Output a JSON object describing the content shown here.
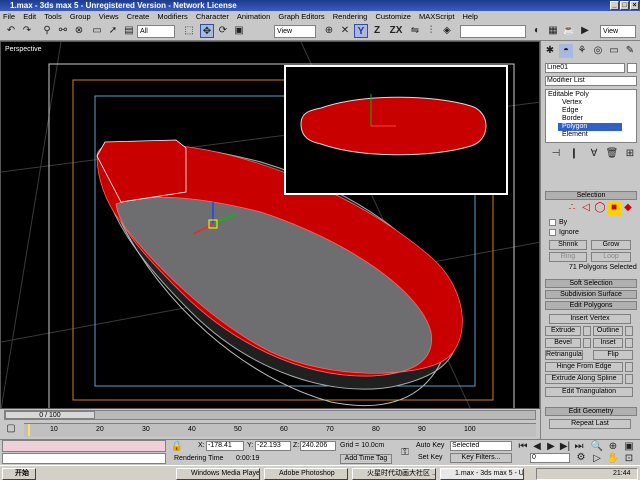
{
  "window": {
    "title": "1.max - 3ds max 5 - Unregistered Version - Network License"
  },
  "menu": [
    "File",
    "Edit",
    "Tools",
    "Group",
    "Views",
    "Create",
    "Modifiers",
    "Character",
    "Animation",
    "Graph Editors",
    "Rendering",
    "Customize",
    "MAXScript",
    "Help"
  ],
  "toolbar": {
    "selection_filter": "All",
    "ref_coord": "View",
    "ref_coord2": "View",
    "axis_y": "Y",
    "axis_z": "Z",
    "axis_zx": "ZX"
  },
  "viewport": {
    "label": "Perspective"
  },
  "command_panel": {
    "object_name": "Line01",
    "modifier_list": "Modifier List",
    "stack": [
      "Editable Poly",
      "Vertex",
      "Edge",
      "Border",
      "Polygon",
      "Element"
    ],
    "selection_head": "Selection",
    "by_label": "By",
    "ignore_label": "Ignore",
    "shrink": "Shrink",
    "grow": "Grow",
    "ring": "Ring",
    "loop": "Loop",
    "polys_selected": "71 Polygons Selected",
    "soft_selection": "Soft Selection",
    "subdivision_surface": "Subdivision Surface",
    "edit_polygons": "Edit Polygons",
    "insert_vertex": "Insert Vertex",
    "extrude": "Extrude",
    "outline": "Outline",
    "bevel": "Bevel",
    "inset": "Inset",
    "triangulate": "Retriangulate",
    "flip": "Flip",
    "hinge": "Hinge From Edge",
    "extrude_spline": "Extrude Along Spline",
    "edit_triangulation": "Edit Triangulation",
    "edit_geometry": "Edit Geometry",
    "repeat_last": "Repeat Last"
  },
  "timeline": {
    "frame_label": "0 / 100",
    "ticks": [
      "0",
      "10",
      "20",
      "30",
      "40",
      "50",
      "60",
      "70",
      "80",
      "90",
      "100"
    ]
  },
  "status": {
    "x_label": "X:",
    "x_value": "-178.41",
    "y_label": "Y:",
    "y_value": "-22.193",
    "z_label": "Z:",
    "z_value": "240.206",
    "grid": "Grid = 10.0cm",
    "auto_key": "Auto Key",
    "selected": "Selected",
    "set_key": "Set Key",
    "key_filters": "Key Filters...",
    "rendering_time": "Rendering Time",
    "rendering_time_value": "0:00:19",
    "add_time_tag": "Add Time Tag",
    "frame_field": "0"
  },
  "taskbar": {
    "start": "开始",
    "items": [
      "Windows Media Player",
      "Adobe Photoshop",
      "火星时代动画大社区 ...",
      "1.max - 3ds max 5 - Un..."
    ],
    "clock": "21:44"
  },
  "colors": {
    "selection_red": "#c80000",
    "title_blue": "#1c3c8c",
    "viewport_bg": "#000000",
    "polygon_highlight": "#3060c8"
  }
}
